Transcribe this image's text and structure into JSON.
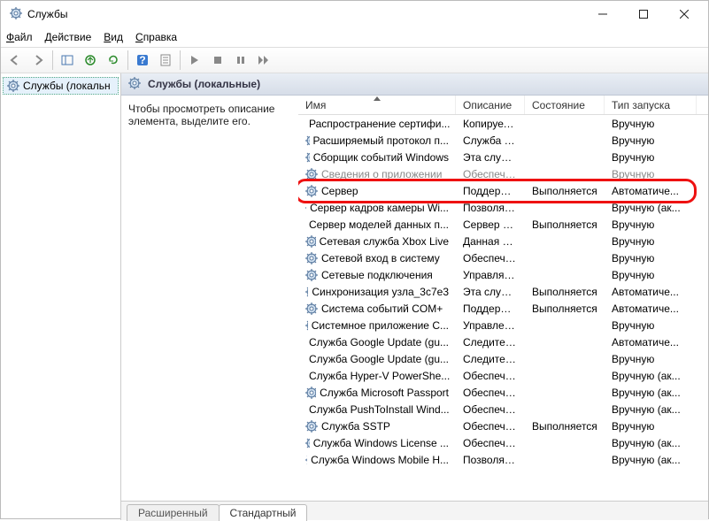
{
  "window": {
    "title": "Службы",
    "menu": {
      "file": "Файл",
      "action": "Действие",
      "view": "Вид",
      "help": "Справка"
    }
  },
  "tree": {
    "root": "Службы (локальн"
  },
  "panel": {
    "heading": "Службы (локальные)",
    "desc": "Чтобы просмотреть описание элемента, выделите его."
  },
  "columns": {
    "name": "Имя",
    "desc": "Описание",
    "state": "Состояние",
    "start": "Тип запуска"
  },
  "tabs": {
    "extended": "Расширенный",
    "standard": "Стандартный"
  },
  "services": [
    {
      "name": "Распространение сертифи...",
      "desc": "Копирует ...",
      "state": "",
      "start": "Вручную"
    },
    {
      "name": "Расширяемый протокол п...",
      "desc": "Служба ра...",
      "state": "",
      "start": "Вручную"
    },
    {
      "name": "Сборщик событий Windows",
      "desc": "Эта служб...",
      "state": "",
      "start": "Вручную"
    },
    {
      "name": "Сведения о приложении",
      "desc": "Обеспечи...",
      "state": "",
      "start": "Вручную"
    },
    {
      "name": "Сервер",
      "desc": "Поддержи...",
      "state": "Выполняется",
      "start": "Автоматиче...",
      "hl": true
    },
    {
      "name": "Сервер кадров камеры Wi...",
      "desc": "Позволяет...",
      "state": "",
      "start": "Вручную (ак..."
    },
    {
      "name": "Сервер моделей данных п...",
      "desc": "Сервер пл...",
      "state": "Выполняется",
      "start": "Вручную"
    },
    {
      "name": "Сетевая служба Xbox Live",
      "desc": "Данная сл...",
      "state": "",
      "start": "Вручную"
    },
    {
      "name": "Сетевой вход в систему",
      "desc": "Обеспечи...",
      "state": "",
      "start": "Вручную"
    },
    {
      "name": "Сетевые подключения",
      "desc": "Управляет...",
      "state": "",
      "start": "Вручную"
    },
    {
      "name": "Синхронизация узла_3c7e3",
      "desc": "Эта служб...",
      "state": "Выполняется",
      "start": "Автоматиче..."
    },
    {
      "name": "Система событий COM+",
      "desc": "Поддержк...",
      "state": "Выполняется",
      "start": "Автоматиче..."
    },
    {
      "name": "Системное приложение C...",
      "desc": "Управлен...",
      "state": "",
      "start": "Вручную"
    },
    {
      "name": "Служба Google Update (gu...",
      "desc": "Следите за...",
      "state": "",
      "start": "Автоматиче..."
    },
    {
      "name": "Служба Google Update (gu...",
      "desc": "Следите за...",
      "state": "",
      "start": "Вручную"
    },
    {
      "name": "Служба Hyper-V PowerShe...",
      "desc": "Обеспечи...",
      "state": "",
      "start": "Вручную (ак..."
    },
    {
      "name": "Служба Microsoft Passport",
      "desc": "Обеспечи...",
      "state": "",
      "start": "Вручную (ак..."
    },
    {
      "name": "Служба PushToInstall Wind...",
      "desc": "Обеспечи...",
      "state": "",
      "start": "Вручную (ак..."
    },
    {
      "name": "Служба SSTP",
      "desc": "Обеспечи...",
      "state": "Выполняется",
      "start": "Вручную"
    },
    {
      "name": "Служба Windows License ...",
      "desc": "Обеспечи...",
      "state": "",
      "start": "Вручную (ак..."
    },
    {
      "name": "Служба Windows Mobile H...",
      "desc": "Позволяет...",
      "state": "",
      "start": "Вручную (ак..."
    }
  ]
}
